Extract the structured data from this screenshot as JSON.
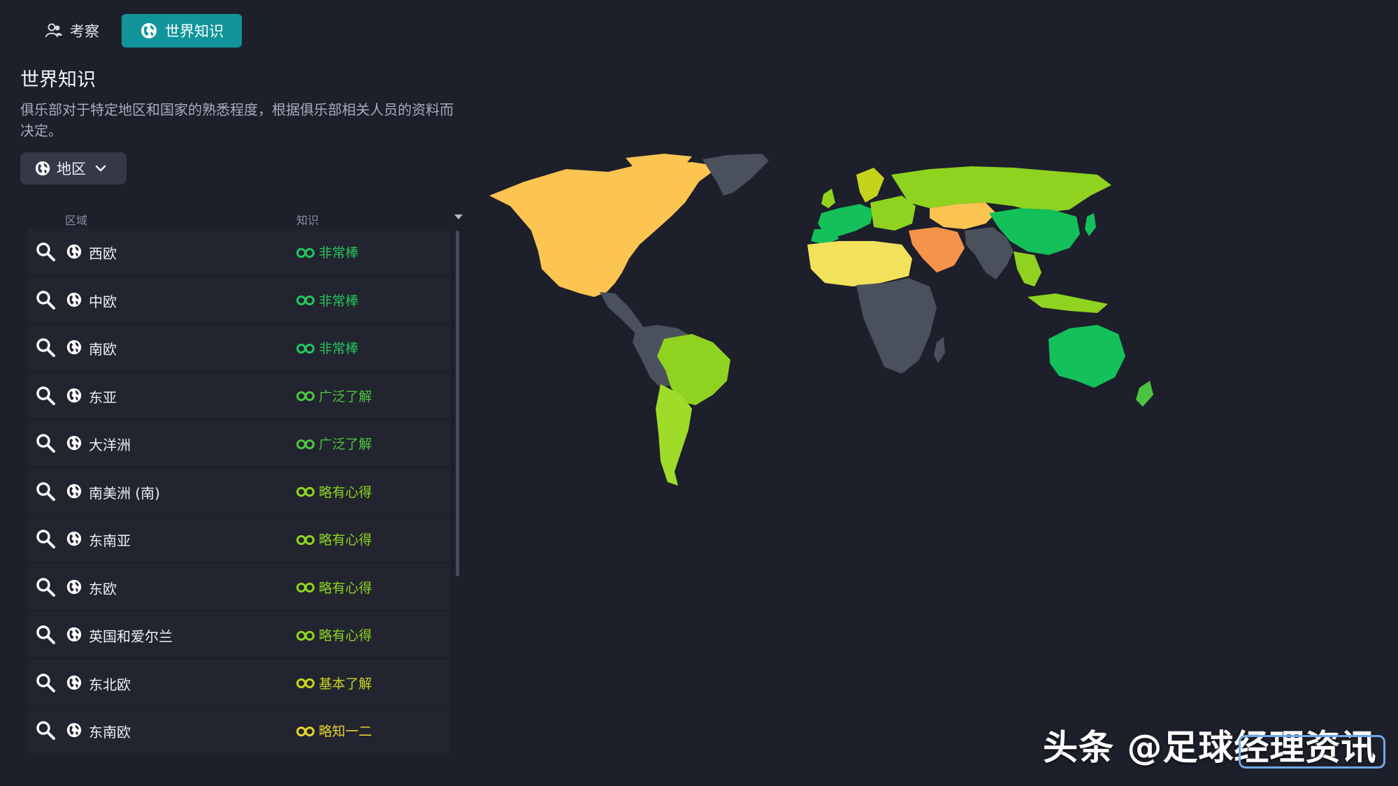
{
  "tabs": [
    {
      "label": "考察",
      "icon": "users-icon",
      "active": false
    },
    {
      "label": "世界知识",
      "icon": "globe-icon",
      "active": true
    }
  ],
  "page": {
    "title": "世界知识",
    "description": "俱乐部对于特定地区和国家的熟悉程度，根据俱乐部相关人员的资料而决定。"
  },
  "dropdown": {
    "label": "地区",
    "icon": "globe-icon"
  },
  "table": {
    "headers": {
      "region": "区域",
      "knowledge": "知识"
    },
    "rows": [
      {
        "region": "西欧",
        "knowledge": "非常棒",
        "color": "#22c55e"
      },
      {
        "region": "中欧",
        "knowledge": "非常棒",
        "color": "#22c55e"
      },
      {
        "region": "南欧",
        "knowledge": "非常棒",
        "color": "#22c55e"
      },
      {
        "region": "东亚",
        "knowledge": "广泛了解",
        "color": "#4cc43f"
      },
      {
        "region": "大洋洲",
        "knowledge": "广泛了解",
        "color": "#4cc43f"
      },
      {
        "region": "南美洲 (南)",
        "knowledge": "略有心得",
        "color": "#8fd320"
      },
      {
        "region": "东南亚",
        "knowledge": "略有心得",
        "color": "#8fd320"
      },
      {
        "region": "东欧",
        "knowledge": "略有心得",
        "color": "#8fd320"
      },
      {
        "region": "英国和爱尔兰",
        "knowledge": "略有心得",
        "color": "#8fd320"
      },
      {
        "region": "东北欧",
        "knowledge": "基本了解",
        "color": "#c4d41c"
      },
      {
        "region": "东南欧",
        "knowledge": "略知一二",
        "color": "#e5d32a"
      }
    ]
  },
  "map_colors": {
    "north_america": "#fcc451",
    "greenland": "#4a515c",
    "central_america": "#4a515c",
    "south_america_north": "#4a515c",
    "brazil": "#8fd320",
    "south_america_south": "#9fdc2a",
    "western_europe": "#13c05a",
    "eastern_europe": "#8fd320",
    "russia": "#8fd320",
    "central_asia": "#fcc451",
    "middle_east": "#f6934a",
    "north_africa": "#f2e25b",
    "sub_saharan_africa": "#4a515c",
    "south_asia": "#4a515c",
    "china": "#13c05a",
    "southeast_asia": "#8fd320",
    "australia": "#13c05a",
    "new_zealand": "#4cc43f",
    "ocean": "#1d1f2b"
  },
  "watermark": "头条 @足球经理资讯"
}
